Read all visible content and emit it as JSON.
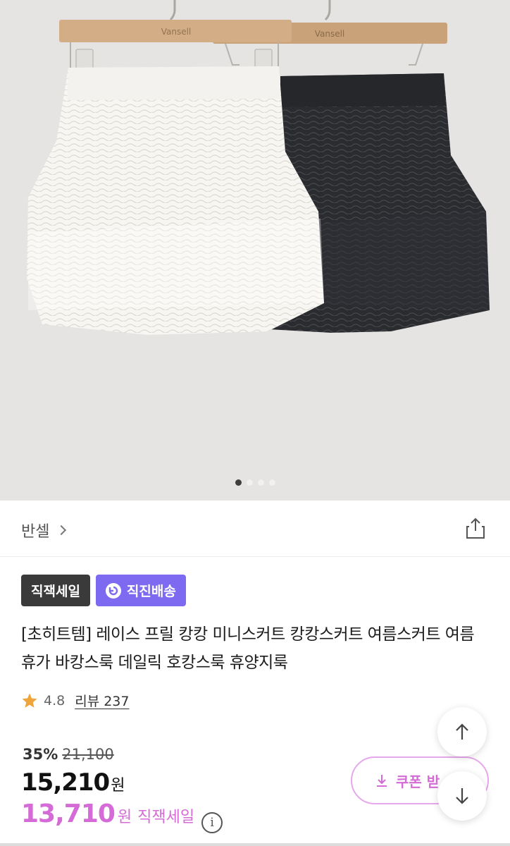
{
  "gallery": {
    "hanger_label_front": "Vansell",
    "hanger_label_back": "Vansell",
    "slide_count": 4,
    "active_slide": 1
  },
  "brand": {
    "name": "반셀"
  },
  "badges": {
    "sale": "직잭세일",
    "delivery": "직진배송"
  },
  "product": {
    "title": "[초히트템] 레이스 프릴 캉캉 미니스커트 캉캉스커트 여름스커트 여름휴가 바캉스룩 데일릭 호캉스룩 휴양지룩"
  },
  "rating": {
    "score": "4.8",
    "review_label": "리뷰 237"
  },
  "price": {
    "discount_rate": "35%",
    "original": "21,100",
    "current": "15,210",
    "currency": "원",
    "sale_price": "13,710",
    "sale_label": "직잭세일",
    "info_glyph": "i"
  },
  "coupon": {
    "label": "쿠폰 받"
  },
  "colors": {
    "accent_pink": "#d46bd6",
    "badge_purple": "#7d6af0",
    "badge_dark": "#3a3a3a",
    "star": "#f0a53c"
  }
}
